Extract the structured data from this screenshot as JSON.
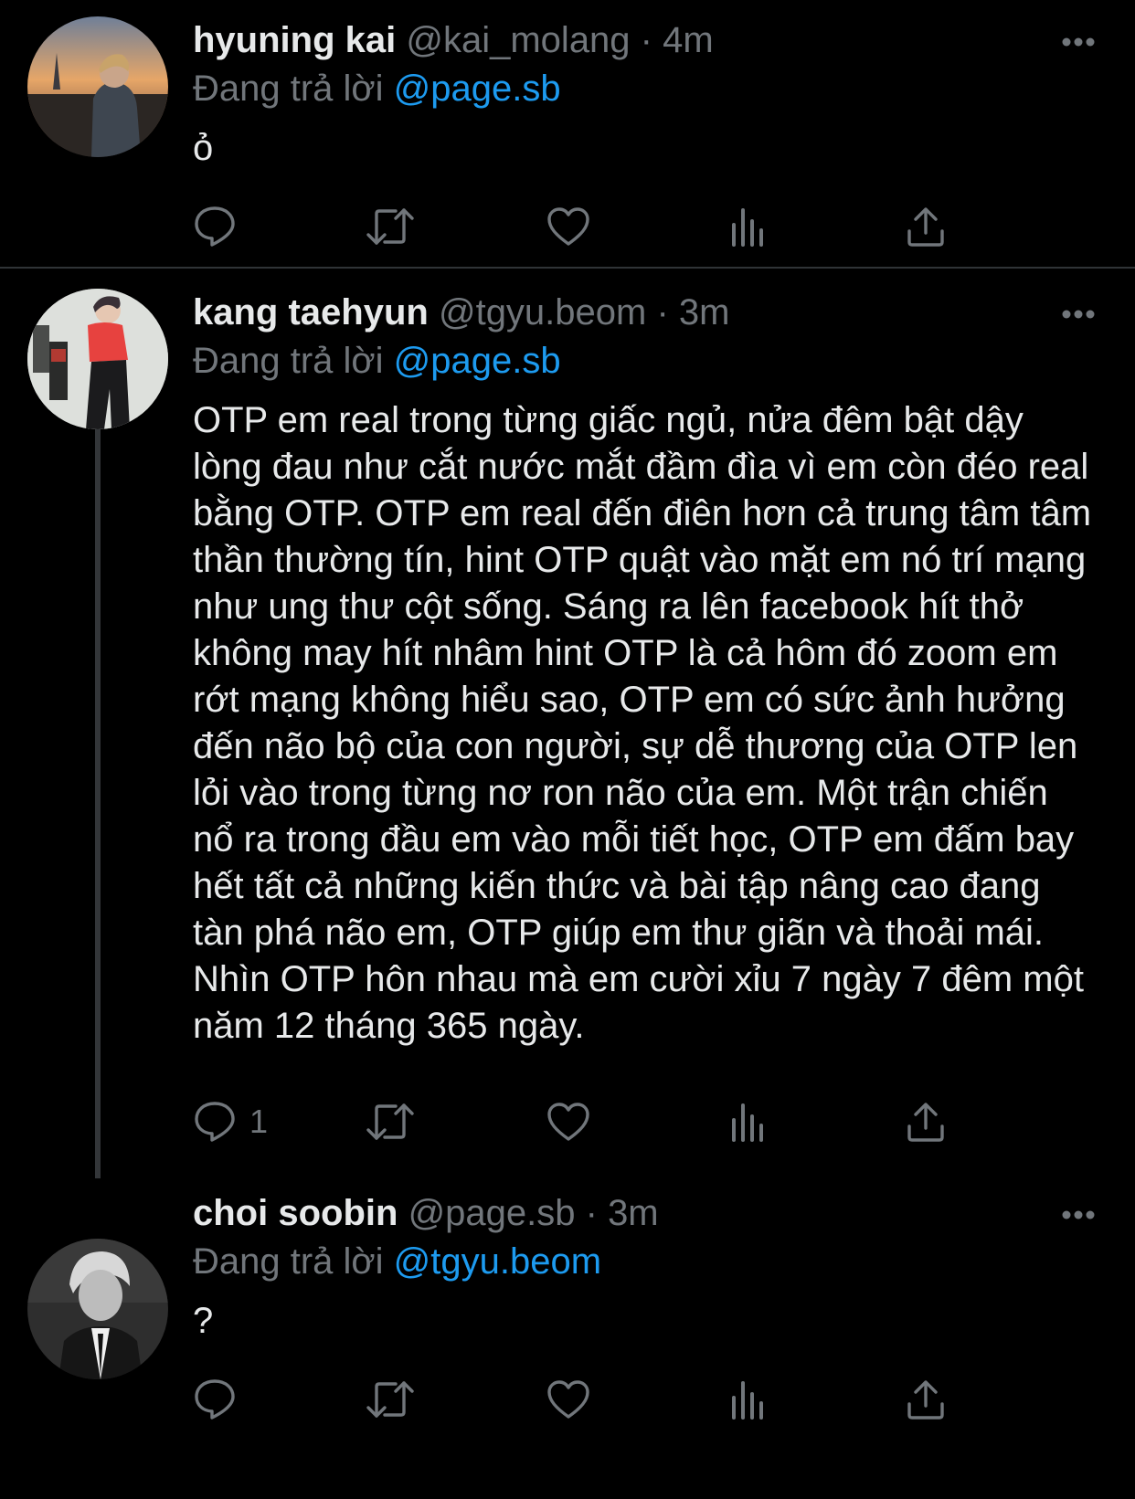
{
  "tweets": [
    {
      "name": "hyuning kai",
      "handle": "@kai_molang",
      "separator": " · ",
      "time": "4m",
      "reply_prefix": "Đang trả lời ",
      "reply_to": "@page.sb",
      "text": "ỏ",
      "reply_count": ""
    },
    {
      "name": "kang taehyun",
      "handle": "@tgyu.beom",
      "separator": " · ",
      "time": "3m",
      "reply_prefix": "Đang trả lời ",
      "reply_to": "@page.sb",
      "text": "OTP em real trong từng giấc ngủ, nửa đêm bật dậy lòng đau như cắt nước mắt đầm đìa vì em còn đéo real bằng OTP. OTP em real đến điên hơn cả trung tâm tâm thần thường tín, hint OTP quật vào mặt em nó trí mạng như ung thư cột sống. Sáng ra lên facebook hít thở không may hít nhâm hint OTP là cả hôm đó zoom em rớt mạng không hiểu sao, OTP em có sức ảnh hưởng đến não bộ của con người, sự dễ thương của OTP len lỏi vào trong từng nơ ron não của em. Một trận chiến nổ ra trong đầu em vào mỗi tiết học, OTP em đấm bay hết tất cả những kiến thức và bài tập nâng cao đang tàn phá não em, OTP giúp em thư giãn và thoải mái. Nhìn OTP hôn nhau mà em cười xỉu 7 ngày 7 đêm một năm 12 tháng 365 ngày.",
      "reply_count": "1"
    },
    {
      "name": "choi soobin",
      "handle": "@page.sb",
      "separator": " · ",
      "time": "3m",
      "reply_prefix": "Đang trả lời ",
      "reply_to": "@tgyu.beom",
      "text": "?",
      "reply_count": ""
    }
  ],
  "icons": {
    "reply": "reply-icon",
    "retweet": "retweet-icon",
    "like": "heart-icon",
    "views": "analytics-icon",
    "share": "share-icon",
    "more": "more-icon"
  },
  "colors": {
    "background": "#000000",
    "text": "#e7e9ea",
    "muted": "#71767b",
    "accent": "#1d9bf0",
    "divider": "#2f3336"
  }
}
